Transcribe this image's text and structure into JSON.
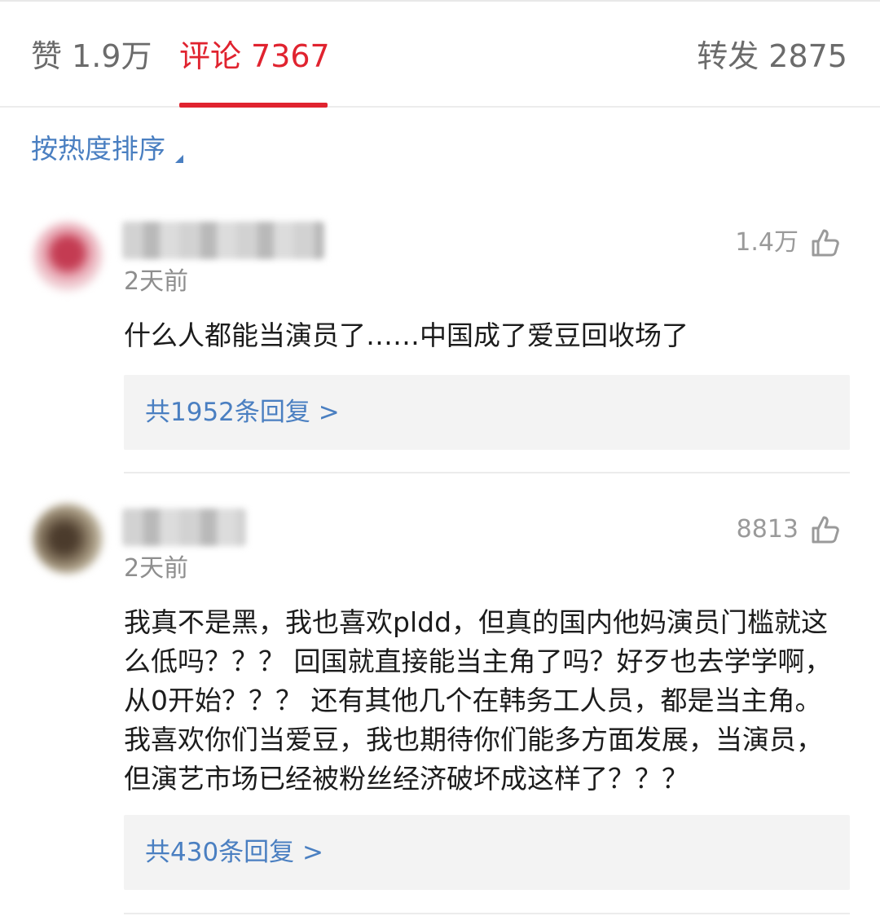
{
  "tabs": {
    "likes": {
      "label": "赞",
      "count": "1.9万"
    },
    "comments": {
      "label": "评论",
      "count": "7367"
    },
    "reposts": {
      "label": "转发",
      "count": "2875"
    }
  },
  "sort": {
    "label": "按热度排序"
  },
  "comments": [
    {
      "time": "2天前",
      "likes": "1.4万",
      "text": "什么人都能当演员了……中国成了爱豆回收场了",
      "replies": "共1952条回复 >"
    },
    {
      "time": "2天前",
      "likes": "8813",
      "text_lines": [
        "我真不是黑，我也喜欢pldd，但真的国内他妈演员门槛就这",
        "么低吗？？？ 回国就直接能当主角了吗？好歹也去学学啊，",
        "从0开始？？？ 还有其他几个在韩务工人员，都是当主角。",
        "我喜欢你们当爱豆，我也期待你们能多方面发展，当演员，",
        "但演艺市场已经被粉丝经济破坏成这样了？？？"
      ],
      "replies": "共430条回复 >"
    }
  ],
  "colors": {
    "accent": "#e0232f",
    "link": "#4a7fc1",
    "muted": "#8e8e8e"
  },
  "icons": {
    "like": "thumbs-up-icon",
    "sort": "caret-icon"
  }
}
